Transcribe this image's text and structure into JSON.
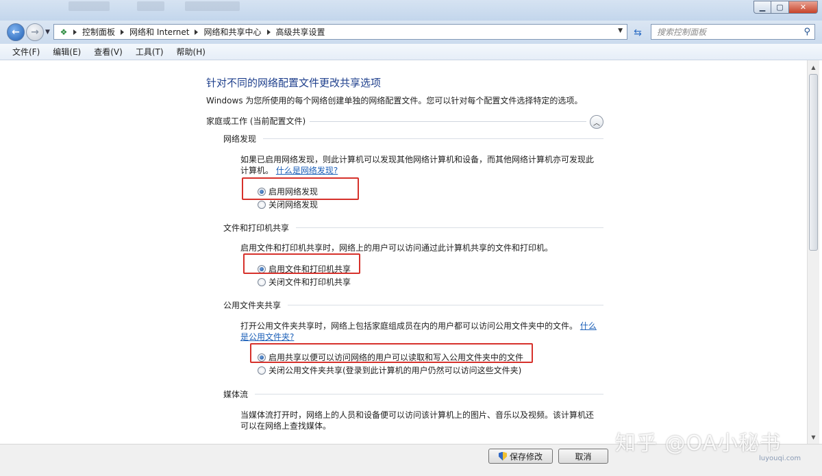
{
  "nav": {
    "breadcrumbs": [
      "控制面板",
      "网络和 Internet",
      "网络和共享中心",
      "高级共享设置"
    ],
    "search_placeholder": "搜索控制面板"
  },
  "menu": [
    "文件(F)",
    "编辑(E)",
    "查看(V)",
    "工具(T)",
    "帮助(H)"
  ],
  "page": {
    "title": "针对不同的网络配置文件更改共享选项",
    "description": "Windows 为您所使用的每个网络创建单独的网络配置文件。您可以针对每个配置文件选择特定的选项。",
    "profile_header": "家庭或工作 (当前配置文件)"
  },
  "sections": {
    "discovery": {
      "title": "网络发现",
      "text_line1": "如果已启用网络发现，则此计算机可以发现其他网络计算机和设备，而其他网络计算机亦可发现此",
      "text_line2": "计算机。",
      "link": "什么是网络发现?",
      "option_on": "启用网络发现",
      "option_off": "关闭网络发现"
    },
    "file_printer": {
      "title": "文件和打印机共享",
      "text": "启用文件和打印机共享时，网络上的用户可以访问通过此计算机共享的文件和打印机。",
      "option_on": "启用文件和打印机共享",
      "option_off": "关闭文件和打印机共享"
    },
    "public_folder": {
      "title": "公用文件夹共享",
      "text_line1": "打开公用文件夹共享时，网络上包括家庭组成员在内的用户都可以访问公用文件夹中的文件。",
      "link_part1": "什么",
      "link_part2": "是公用文件夹?",
      "option_on": "启用共享以便可以访问网络的用户可以读取和写入公用文件夹中的文件",
      "option_off": "关闭公用文件夹共享(登录到此计算机的用户仍然可以访问这些文件夹)"
    },
    "media": {
      "title": "媒体流",
      "text_line1": "当媒体流打开时，网络上的人员和设备便可以访问该计算机上的图片、音乐以及视频。该计算机还",
      "text_line2": "可以在网络上查找媒体。"
    }
  },
  "buttons": {
    "save": "保存修改",
    "cancel": "取消"
  },
  "watermark": {
    "text": "知乎 @OA小秘书",
    "sub": "luyouqi.com"
  },
  "colors": {
    "title_blue": "#1e3f8c",
    "link_blue": "#1b5fb8",
    "highlight_red": "#d6302a"
  }
}
